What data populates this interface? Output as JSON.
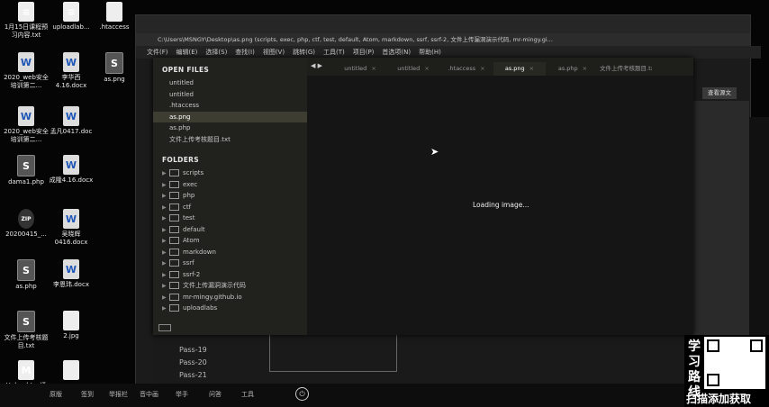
{
  "desktop": {
    "icons": [
      {
        "label": "1月15日课程预习内容.txt",
        "kind": "file",
        "glyph": "≡"
      },
      {
        "label": "uploadlab...",
        "kind": "file",
        "glyph": "≡"
      },
      {
        "label": ".htaccess",
        "kind": "file",
        "glyph": ""
      },
      {
        "label": "2020_web安全培训第二...",
        "kind": "word",
        "glyph": "W"
      },
      {
        "label": "李华西4.16.docx",
        "kind": "word",
        "glyph": "W"
      },
      {
        "label": "as.png",
        "kind": "sublime",
        "glyph": "S"
      },
      {
        "label": "2020_web安全培训第二...",
        "kind": "word",
        "glyph": "W"
      },
      {
        "label": "孟凡0417.doc",
        "kind": "word",
        "glyph": "W"
      },
      {
        "label": "dama1.php",
        "kind": "sublime",
        "glyph": "S"
      },
      {
        "label": "成隆4.16.docx",
        "kind": "word",
        "glyph": "W"
      },
      {
        "label": "20200415_...",
        "kind": "zip",
        "glyph": "ZIP"
      },
      {
        "label": "吴晓辉0416.docx",
        "kind": "word",
        "glyph": "W"
      },
      {
        "label": "as.php",
        "kind": "sublime",
        "glyph": "S"
      },
      {
        "label": "李恩玮.docx",
        "kind": "word",
        "glyph": "W"
      },
      {
        "label": "文件上传考核题目.txt",
        "kind": "sublime",
        "glyph": "S"
      },
      {
        "label": "2.jpg",
        "kind": "file",
        "glyph": ""
      },
      {
        "label": "Upload-L...通关.md",
        "kind": "file",
        "glyph": "M"
      },
      {
        "label": "",
        "kind": "file",
        "glyph": ""
      }
    ]
  },
  "browser": {
    "address": "C:\\Users\\MSNGY\\Desktop\\as.png (scripts, exec, php, ctf, test, default, Atom, markdown, ssrf, ssrf-2, 文件上传漏洞演示代码, mr-mingy.gi...",
    "menu": [
      "文件(F)",
      "编辑(E)",
      "选择(S)",
      "查找(I)",
      "视图(V)",
      "跳转(G)",
      "工具(T)",
      "项目(P)",
      "首选项(N)",
      "帮助(H)"
    ],
    "right_button": "查看源文"
  },
  "editor": {
    "open_files_header": "OPEN FILES",
    "open_files": [
      "untitled",
      "untitled",
      ".htaccess",
      "as.png",
      "as.php",
      "文件上传考核题目.txt"
    ],
    "active_file_index": 3,
    "folders_header": "FOLDERS",
    "folders": [
      "scripts",
      "exec",
      "php",
      "ctf",
      "test",
      "default",
      "Atom",
      "markdown",
      "ssrf",
      "ssrf-2",
      "文件上传漏洞演示代码",
      "mr-mingy.github.io",
      "uploadlabs"
    ],
    "tabs": [
      "untitled",
      "untitled",
      ".htaccess",
      "as.png",
      "as.php",
      "文件上传考核题目.txt"
    ],
    "active_tab_index": 3,
    "viewer_status": "Loading image..."
  },
  "background_page": {
    "pass_items": [
      "Pass-19",
      "Pass-20",
      "Pass-21"
    ]
  },
  "taskbar": {
    "items": [
      "原版",
      "签到",
      "举报栏",
      "音中画",
      "举手",
      "问答",
      "工具"
    ]
  },
  "overlay": {
    "chars": [
      "学",
      "习",
      "路",
      "线",
      "扫描添加获取"
    ]
  }
}
